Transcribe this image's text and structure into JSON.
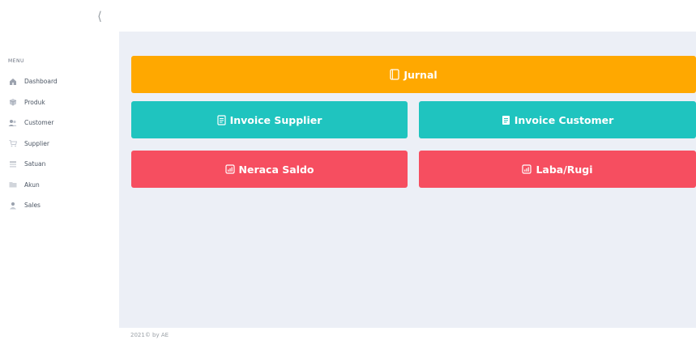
{
  "sidebar": {
    "collapse_icon": "chevron-left-icon",
    "menu_title": "MENU",
    "items": [
      {
        "label": "Dashboard",
        "icon": "home-icon"
      },
      {
        "label": "Produk",
        "icon": "box-icon"
      },
      {
        "label": "Customer",
        "icon": "users-icon"
      },
      {
        "label": "Supplier",
        "icon": "cart-icon"
      },
      {
        "label": "Satuan",
        "icon": "list-icon"
      },
      {
        "label": "Akun",
        "icon": "folder-icon"
      },
      {
        "label": "Sales",
        "icon": "user-icon"
      }
    ]
  },
  "tiles": {
    "jurnal": {
      "label": "Jurnal",
      "icon": "journal-icon",
      "color": "#ffa800"
    },
    "invoice_supplier": {
      "label": "Invoice Supplier",
      "icon": "document-icon",
      "color": "#1fc4bf"
    },
    "invoice_customer": {
      "label": "Invoice Customer",
      "icon": "document-filled-icon",
      "color": "#1fc4bf"
    },
    "neraca_saldo": {
      "label": "Neraca Saldo",
      "icon": "bar-chart-icon",
      "color": "#f64e60"
    },
    "laba_rugi": {
      "label": "Laba/Rugi",
      "icon": "bar-chart-icon",
      "color": "#f64e60"
    }
  },
  "footer": {
    "text": "2021© by AE"
  }
}
